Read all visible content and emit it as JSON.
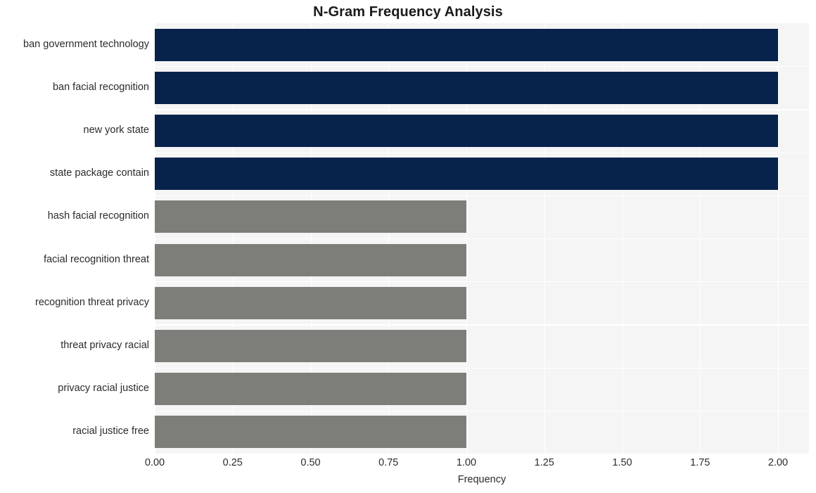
{
  "chart_data": {
    "type": "bar",
    "orientation": "horizontal",
    "title": "N-Gram Frequency Analysis",
    "xlabel": "Frequency",
    "ylabel": "",
    "xlim": [
      0.0,
      2.0
    ],
    "xticks": [
      "0.00",
      "0.25",
      "0.50",
      "0.75",
      "1.00",
      "1.25",
      "1.50",
      "1.75",
      "2.00"
    ],
    "xtick_values": [
      0.0,
      0.25,
      0.5,
      0.75,
      1.0,
      1.25,
      1.5,
      1.75,
      2.0
    ],
    "grid": true,
    "legend": "none",
    "categories": [
      "ban government technology",
      "ban facial recognition",
      "new york state",
      "state package contain",
      "hash facial recognition",
      "facial recognition threat",
      "recognition threat privacy",
      "threat privacy racial",
      "privacy racial justice",
      "racial justice free"
    ],
    "values": [
      2,
      2,
      2,
      2,
      1,
      1,
      1,
      1,
      1,
      1
    ],
    "bar_colors": [
      "#07234c",
      "#07234c",
      "#07234c",
      "#07234c",
      "#7d7d79",
      "#7d7d79",
      "#7d7d79",
      "#7d7d79",
      "#7d7d79",
      "#7d7d79"
    ],
    "palette": {
      "highlight": "#07234c",
      "base": "#7d7d79",
      "plot_background": "#f5f5f5",
      "gridline": "#ffffff",
      "figure_background": "#ffffff",
      "text": "#2b2b2b",
      "title_text": "#1a1a1a"
    }
  }
}
